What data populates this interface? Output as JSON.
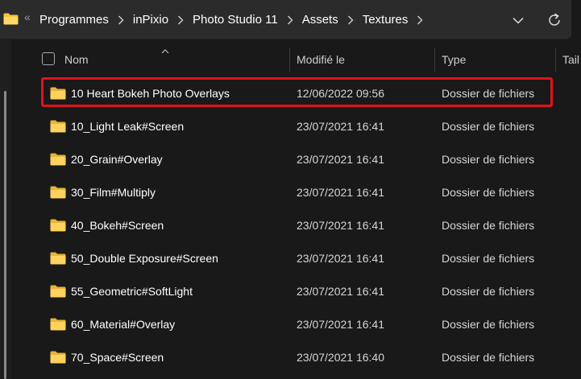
{
  "address_bar": {
    "overflow_glyph": "«",
    "breadcrumbs": [
      "Programmes",
      "inPixio",
      "Photo Studio 11",
      "Assets",
      "Textures"
    ],
    "icons": {
      "location": "folder-icon",
      "dropdown": "chevron-down-icon",
      "refresh": "refresh-icon",
      "separator": "chevron-right-icon"
    }
  },
  "columns": {
    "name": "Nom",
    "modified": "Modifié le",
    "type": "Type",
    "size": "Tail"
  },
  "files": [
    {
      "name": "10 Heart Bokeh Photo Overlays",
      "modified": "12/06/2022 09:56",
      "type": "Dossier de fichiers",
      "highlighted": true
    },
    {
      "name": "10_Light Leak#Screen",
      "modified": "23/07/2021 16:41",
      "type": "Dossier de fichiers"
    },
    {
      "name": "20_Grain#Overlay",
      "modified": "23/07/2021 16:41",
      "type": "Dossier de fichiers"
    },
    {
      "name": "30_Film#Multiply",
      "modified": "23/07/2021 16:41",
      "type": "Dossier de fichiers"
    },
    {
      "name": "40_Bokeh#Screen",
      "modified": "23/07/2021 16:41",
      "type": "Dossier de fichiers"
    },
    {
      "name": "50_Double Exposure#Screen",
      "modified": "23/07/2021 16:41",
      "type": "Dossier de fichiers"
    },
    {
      "name": "55_Geometric#SoftLight",
      "modified": "23/07/2021 16:41",
      "type": "Dossier de fichiers"
    },
    {
      "name": "60_Material#Overlay",
      "modified": "23/07/2021 16:41",
      "type": "Dossier de fichiers"
    },
    {
      "name": "70_Space#Screen",
      "modified": "23/07/2021 16:40",
      "type": "Dossier de fichiers"
    }
  ],
  "colors": {
    "background": "#191919",
    "address_bar": "#2b2b2b",
    "highlight": "#e0121d",
    "folder": "#f5c542"
  }
}
